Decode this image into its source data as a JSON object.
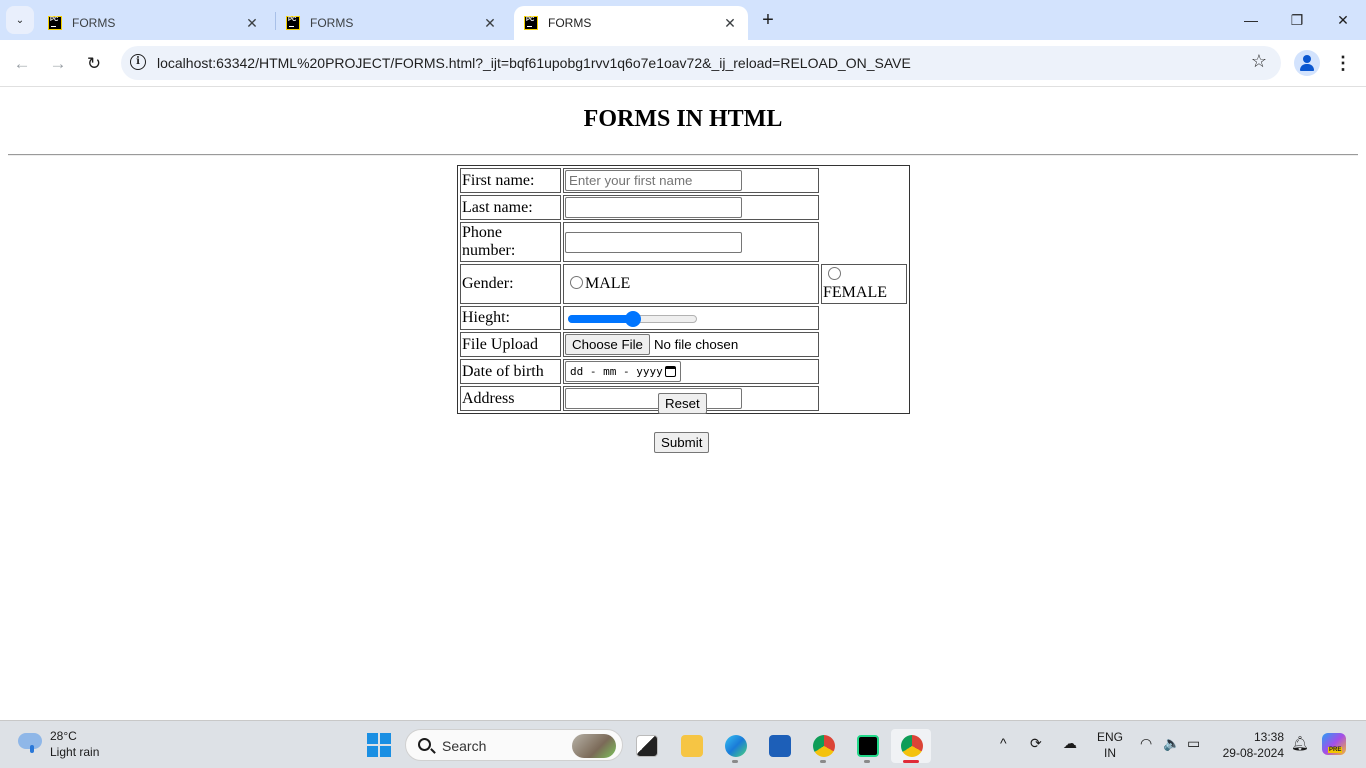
{
  "browser": {
    "tabs": [
      {
        "title": "FORMS",
        "favicon": "pycharm-icon",
        "active": false
      },
      {
        "title": "FORMS",
        "favicon": "pycharm-icon",
        "active": false
      },
      {
        "title": "FORMS",
        "favicon": "pycharm-icon",
        "active": true
      }
    ],
    "tab_list_icon": "⌄",
    "close_icon": "✕",
    "new_tab_icon": "+",
    "window_controls": {
      "minimize": "—",
      "maximize": "❐",
      "close": "✕"
    },
    "nav": {
      "back": "←",
      "forward": "→",
      "reload": "↻"
    },
    "url": "localhost:63342/HTML%20PROJECT/FORMS.html?_ijt=bqf61upobg1rvv1q6o7e1oav72&_ij_reload=RELOAD_ON_SAVE",
    "site_info_icon": "i",
    "bookmark_icon": "☆",
    "menu_icon": "⋮"
  },
  "page": {
    "heading": "FORMS IN HTML",
    "form": {
      "rows": [
        {
          "label": "First name:",
          "type": "text",
          "placeholder": "Enter your first name",
          "value": ""
        },
        {
          "label": "Last name:",
          "type": "text",
          "placeholder": "",
          "value": ""
        },
        {
          "label": "Phone number:",
          "type": "text",
          "placeholder": "",
          "value": ""
        },
        {
          "label": "Gender:",
          "type": "radio",
          "options": [
            {
              "label": "MALE",
              "checked": false
            },
            {
              "label": "FEMALE",
              "checked": false
            }
          ]
        },
        {
          "label": "Hieght:",
          "type": "range",
          "value": 50,
          "min": 0,
          "max": 100
        },
        {
          "label": "File Upload",
          "type": "file",
          "button_label": "Choose File",
          "status": "No file chosen"
        },
        {
          "label": "Date of birth",
          "type": "date",
          "placeholder": "dd - mm - yyyy"
        },
        {
          "label": "Address",
          "type": "text",
          "placeholder": "",
          "value": ""
        }
      ]
    },
    "reset_label": "Reset",
    "submit_label": "Submit"
  },
  "taskbar": {
    "weather": {
      "temp": "28°C",
      "desc": "Light rain"
    },
    "search_label": "Search",
    "apps": [
      "task-view",
      "file-explorer",
      "edge",
      "microsoft-store",
      "chrome-profile",
      "pycharm",
      "chrome-active"
    ],
    "tray": {
      "chevron": "^",
      "lang_top": "ENG",
      "lang_bottom": "IN",
      "wifi": "wifi",
      "volume": "volume",
      "battery": "battery"
    },
    "time": "13:38",
    "date": "29-08-2024",
    "copilot_badge": "PRE"
  }
}
